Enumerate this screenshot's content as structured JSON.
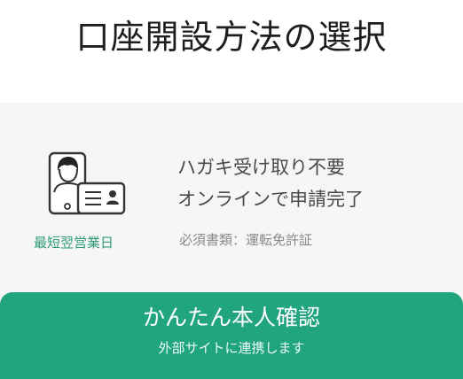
{
  "header": {
    "title": "口座開設方法の選択"
  },
  "option": {
    "illustration_icon": "phone-selfie-with-id-card-icon",
    "badge": "最短翌営業日",
    "features": [
      "ハガキ受け取り不要",
      "オンラインで申請完了"
    ],
    "required_docs": "必須書類：運転免許証"
  },
  "cta": {
    "title": "かんたん本人確認",
    "subtitle": "外部サイトに連携します"
  },
  "colors": {
    "accent": "#21a57e",
    "badge_text": "#2e9a78",
    "card_background": "#f6f6f6"
  }
}
